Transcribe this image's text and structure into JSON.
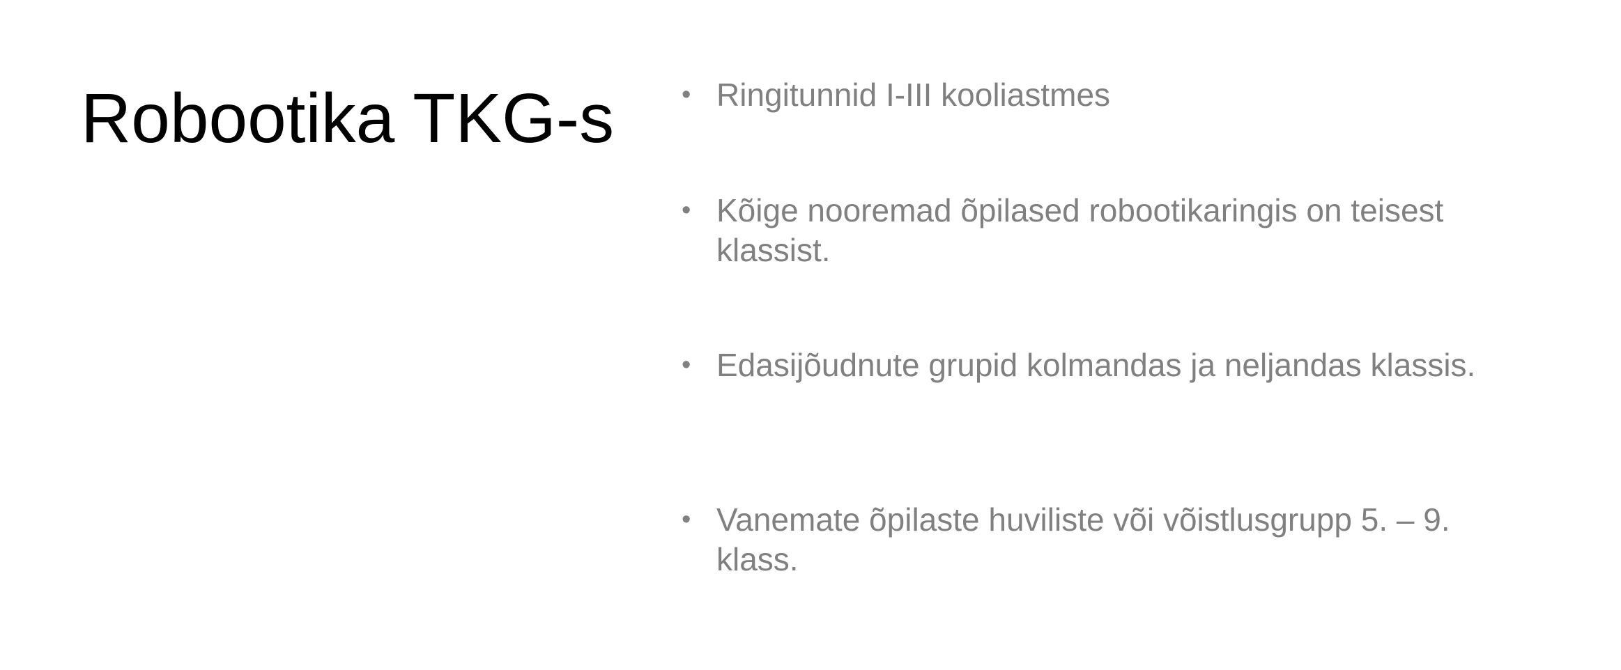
{
  "slide": {
    "title": "Robootika TKG-s",
    "bullets": [
      {
        "marker": "•",
        "text": "Ringitunnid I-III kooliastmes"
      },
      {
        "marker": "•",
        "text": "Kõige nooremad õpilased robootikaringis on teisest klassist."
      },
      {
        "marker": "•",
        "text": "Edasijõudnute grupid kolmandas ja neljandas klassis."
      },
      {
        "marker": "•",
        "text": "Vanemate õpilaste huviliste või võistlusgrupp 5. – 9. klass."
      }
    ]
  },
  "colors": {
    "background": "#ffffff",
    "title": "#000000",
    "bullet_text": "#808080"
  }
}
